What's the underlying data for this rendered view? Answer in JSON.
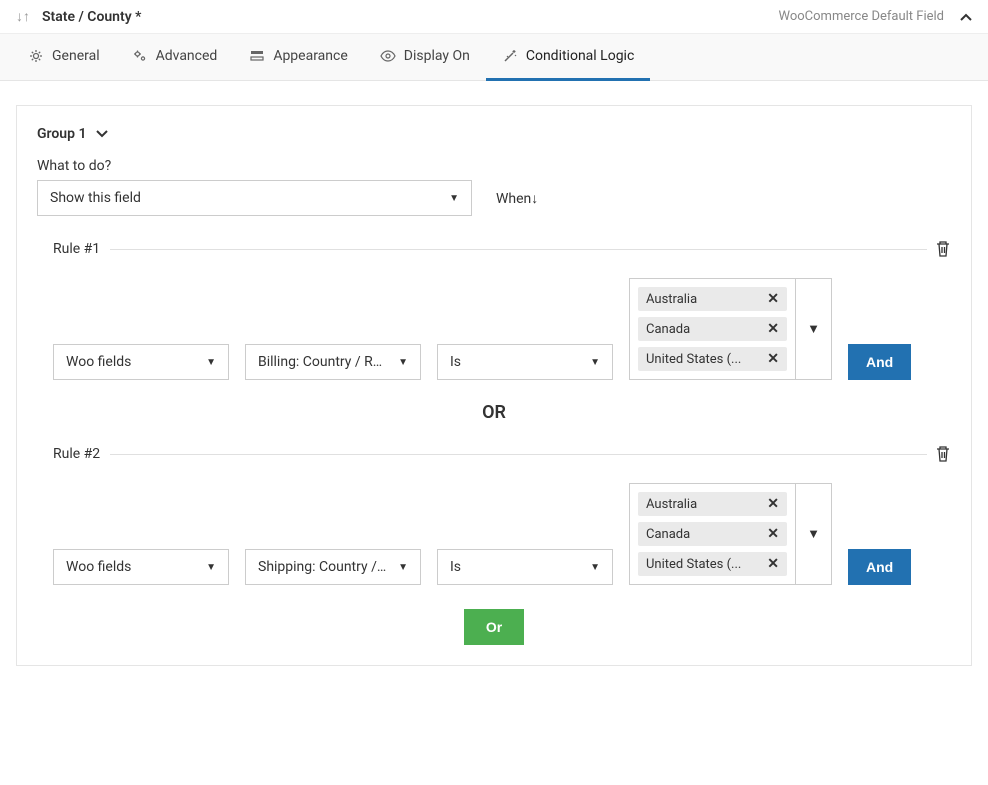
{
  "header": {
    "field_title": "State / County *",
    "field_meta": "WooCommerce Default Field"
  },
  "tabs": [
    {
      "label": "General"
    },
    {
      "label": "Advanced"
    },
    {
      "label": "Appearance"
    },
    {
      "label": "Display On"
    },
    {
      "label": "Conditional Logic"
    }
  ],
  "group": {
    "title": "Group 1",
    "what_to_do_label": "What to do?",
    "action_value": "Show this field",
    "when_label": "When↓"
  },
  "rules": [
    {
      "title": "Rule #1",
      "source": "Woo fields",
      "field": "Billing: Country / Regi...",
      "operator": "Is",
      "tags": [
        "Australia",
        "Canada",
        "United States (..."
      ],
      "connector": "And"
    },
    {
      "title": "Rule #2",
      "source": "Woo fields",
      "field": "Shipping: Country / R...",
      "operator": "Is",
      "tags": [
        "Australia",
        "Canada",
        "United States (..."
      ],
      "connector": "And"
    }
  ],
  "separator": "OR",
  "add_rule": "Or"
}
